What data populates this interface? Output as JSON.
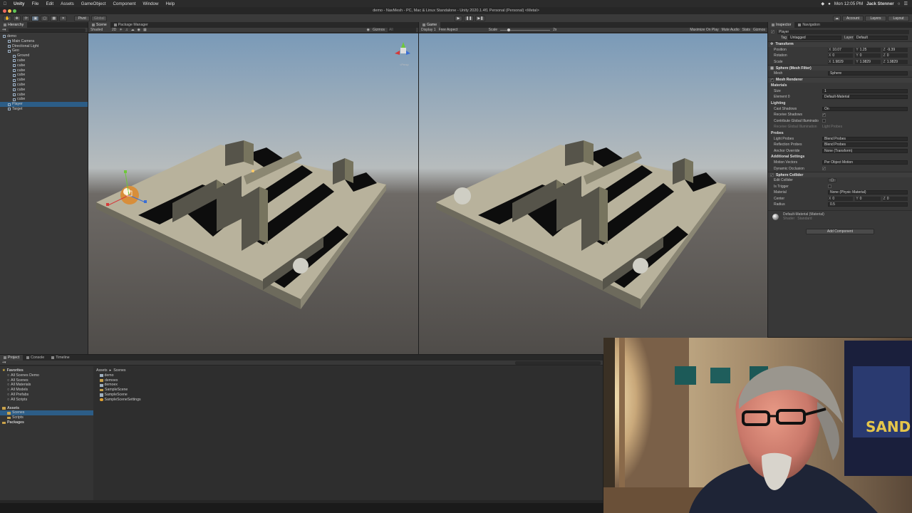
{
  "menubar": {
    "app": "Unity",
    "items": [
      "File",
      "Edit",
      "Assets",
      "GameObject",
      "Component",
      "Window",
      "Help"
    ],
    "clock": "Mon 12:05 PM",
    "user": "Jack Stenner"
  },
  "window_title": "demo - NavMesh - PC, Mac & Linux Standalone - Unity 2020.1.4f1 Personal (Personal) <Metal>",
  "toolbar": {
    "pivot": "Pivot",
    "global": "Global",
    "account": "Account",
    "layers": "Layers",
    "layout": "Layout"
  },
  "hierarchy": {
    "tab": "Hierarchy",
    "items": [
      {
        "label": "demo",
        "indent": 0
      },
      {
        "label": "Main Camera",
        "indent": 1
      },
      {
        "label": "Directional Light",
        "indent": 1
      },
      {
        "label": "Geo",
        "indent": 1
      },
      {
        "label": "Ground",
        "indent": 2
      },
      {
        "label": "cube",
        "indent": 2
      },
      {
        "label": "cube",
        "indent": 2
      },
      {
        "label": "cube",
        "indent": 2
      },
      {
        "label": "cube",
        "indent": 2
      },
      {
        "label": "cube",
        "indent": 2
      },
      {
        "label": "cube",
        "indent": 2
      },
      {
        "label": "cube",
        "indent": 2
      },
      {
        "label": "cube",
        "indent": 2
      },
      {
        "label": "cube",
        "indent": 2
      },
      {
        "label": "Player",
        "indent": 1,
        "selected": true
      },
      {
        "label": "Target",
        "indent": 1
      }
    ]
  },
  "scene": {
    "tabs": [
      "Scene",
      "Package Manager"
    ],
    "shading": "Shaded",
    "mode2d": "2D",
    "gizmos": "Gizmos",
    "all": "All"
  },
  "game": {
    "tab": "Game",
    "display": "Display 1",
    "aspect": "Free Aspect",
    "scale_label": "Scale",
    "scale_value": "2x",
    "buttons": [
      "Maximize On Play",
      "Mute Audio",
      "Stats",
      "Gizmos"
    ]
  },
  "inspector": {
    "tabs": [
      "Inspector",
      "Navigation"
    ],
    "object_name": "Player",
    "tag_label": "Tag",
    "tag": "Untagged",
    "layer_label": "Layer",
    "layer": "Default",
    "transform": {
      "title": "Transform",
      "position_label": "Position",
      "position": [
        "10.07",
        "1.25",
        "-9.39"
      ],
      "rotation_label": "Rotation",
      "rotation": [
        "0",
        "0",
        "0"
      ],
      "scale_label": "Scale",
      "scale": [
        "1.9829",
        "1.9829",
        "1.9829"
      ]
    },
    "mesh_filter": {
      "title": "Sphere (Mesh Filter)",
      "mesh_label": "Mesh",
      "mesh": "Sphere"
    },
    "mesh_renderer": {
      "title": "Mesh Renderer",
      "materials": "Materials",
      "size_label": "Size",
      "size": "1",
      "element_label": "Element 0",
      "element": "Default-Material",
      "lighting": "Lighting",
      "cast_shadows_label": "Cast Shadows",
      "cast_shadows": "On",
      "receive_shadows_label": "Receive Shadows",
      "contribute_gi_label": "Contribute Global Illuminatio",
      "receive_gi_label": "Receive Global Illumination",
      "receive_gi": "Light Probes",
      "probes": "Probes",
      "light_probes_label": "Light Probes",
      "light_probes": "Blend Probes",
      "reflection_probes_label": "Reflection Probes",
      "reflection_probes": "Blend Probes",
      "anchor_label": "Anchor Override",
      "anchor": "None (Transform)",
      "additional": "Additional Settings",
      "motion_label": "Motion Vectors",
      "motion": "Per Object Motion",
      "dynamic_occlusion_label": "Dynamic Occlusion"
    },
    "sphere_collider": {
      "title": "Sphere Collider",
      "edit_label": "Edit Collider",
      "trigger_label": "Is Trigger",
      "material_label": "Material",
      "material": "None (Physic Material)",
      "center_label": "Center",
      "center": [
        "0",
        "0",
        "0"
      ],
      "radius_label": "Radius",
      "radius": "0.5"
    },
    "material": {
      "title": "Default-Material (Material)",
      "shader_label": "Shader",
      "shader": "Standard"
    },
    "add_component": "Add Component"
  },
  "project": {
    "tabs": [
      "Project",
      "Console",
      "Timeline"
    ],
    "favorites_title": "Favorites",
    "favorites": [
      "All Scenes Demo",
      "All Scenes",
      "All Materials",
      "All Models",
      "All Prefabs",
      "All Scripts"
    ],
    "assets_title": "Assets",
    "assets_children": [
      "Scenes",
      "Scripts"
    ],
    "packages_title": "Packages",
    "breadcrumb": [
      "Assets",
      "Scenes"
    ],
    "files": [
      {
        "label": "demo",
        "kind": "scene"
      },
      {
        "label": "demoex",
        "kind": "folder"
      },
      {
        "label": "demoex",
        "kind": "scene"
      },
      {
        "label": "SampleScene",
        "kind": "folder"
      },
      {
        "label": "SampleScene",
        "kind": "scene"
      },
      {
        "label": "SampleSceneSettings",
        "kind": "settings"
      }
    ]
  },
  "colors": {
    "accent_select": "#2c5d87",
    "panel_bg": "#383838",
    "ground": "#b8b29c",
    "wall": "#56544a",
    "shadow": "#0d0d0d"
  }
}
